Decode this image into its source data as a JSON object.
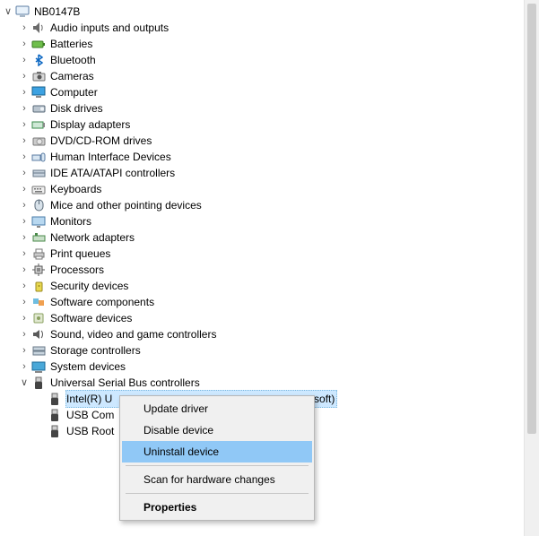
{
  "root": {
    "label": "NB0147B",
    "expanded": true,
    "icon": "computer"
  },
  "categories": [
    {
      "label": "Audio inputs and outputs",
      "icon": "speaker"
    },
    {
      "label": "Batteries",
      "icon": "battery"
    },
    {
      "label": "Bluetooth",
      "icon": "bluetooth"
    },
    {
      "label": "Cameras",
      "icon": "camera"
    },
    {
      "label": "Computer",
      "icon": "monitor"
    },
    {
      "label": "Disk drives",
      "icon": "disk"
    },
    {
      "label": "Display adapters",
      "icon": "display"
    },
    {
      "label": "DVD/CD-ROM drives",
      "icon": "dvd"
    },
    {
      "label": "Human Interface Devices",
      "icon": "hid"
    },
    {
      "label": "IDE ATA/ATAPI controllers",
      "icon": "ide"
    },
    {
      "label": "Keyboards",
      "icon": "keyboard"
    },
    {
      "label": "Mice and other pointing devices",
      "icon": "mouse"
    },
    {
      "label": "Monitors",
      "icon": "monitor2"
    },
    {
      "label": "Network adapters",
      "icon": "network"
    },
    {
      "label": "Print queues",
      "icon": "printer"
    },
    {
      "label": "Processors",
      "icon": "cpu"
    },
    {
      "label": "Security devices",
      "icon": "security"
    },
    {
      "label": "Software components",
      "icon": "swcomp"
    },
    {
      "label": "Software devices",
      "icon": "swdev"
    },
    {
      "label": "Sound, video and game controllers",
      "icon": "sound"
    },
    {
      "label": "Storage controllers",
      "icon": "storage"
    },
    {
      "label": "System devices",
      "icon": "system"
    }
  ],
  "usb": {
    "label": "Universal Serial Bus controllers",
    "icon": "usb",
    "expanded": true,
    "children": [
      {
        "label": "Intel(R) U",
        "tail": "osoft)",
        "icon": "usb",
        "selected": true
      },
      {
        "label": "USB Com",
        "icon": "usb"
      },
      {
        "label": "USB Root",
        "icon": "usb"
      }
    ]
  },
  "context_menu": {
    "items": [
      {
        "label": "Update driver",
        "type": "item"
      },
      {
        "label": "Disable device",
        "type": "item"
      },
      {
        "label": "Uninstall device",
        "type": "item",
        "highlighted": true
      },
      {
        "type": "sep"
      },
      {
        "label": "Scan for hardware changes",
        "type": "item"
      },
      {
        "type": "sep"
      },
      {
        "label": "Properties",
        "type": "item",
        "bold": true
      }
    ]
  }
}
